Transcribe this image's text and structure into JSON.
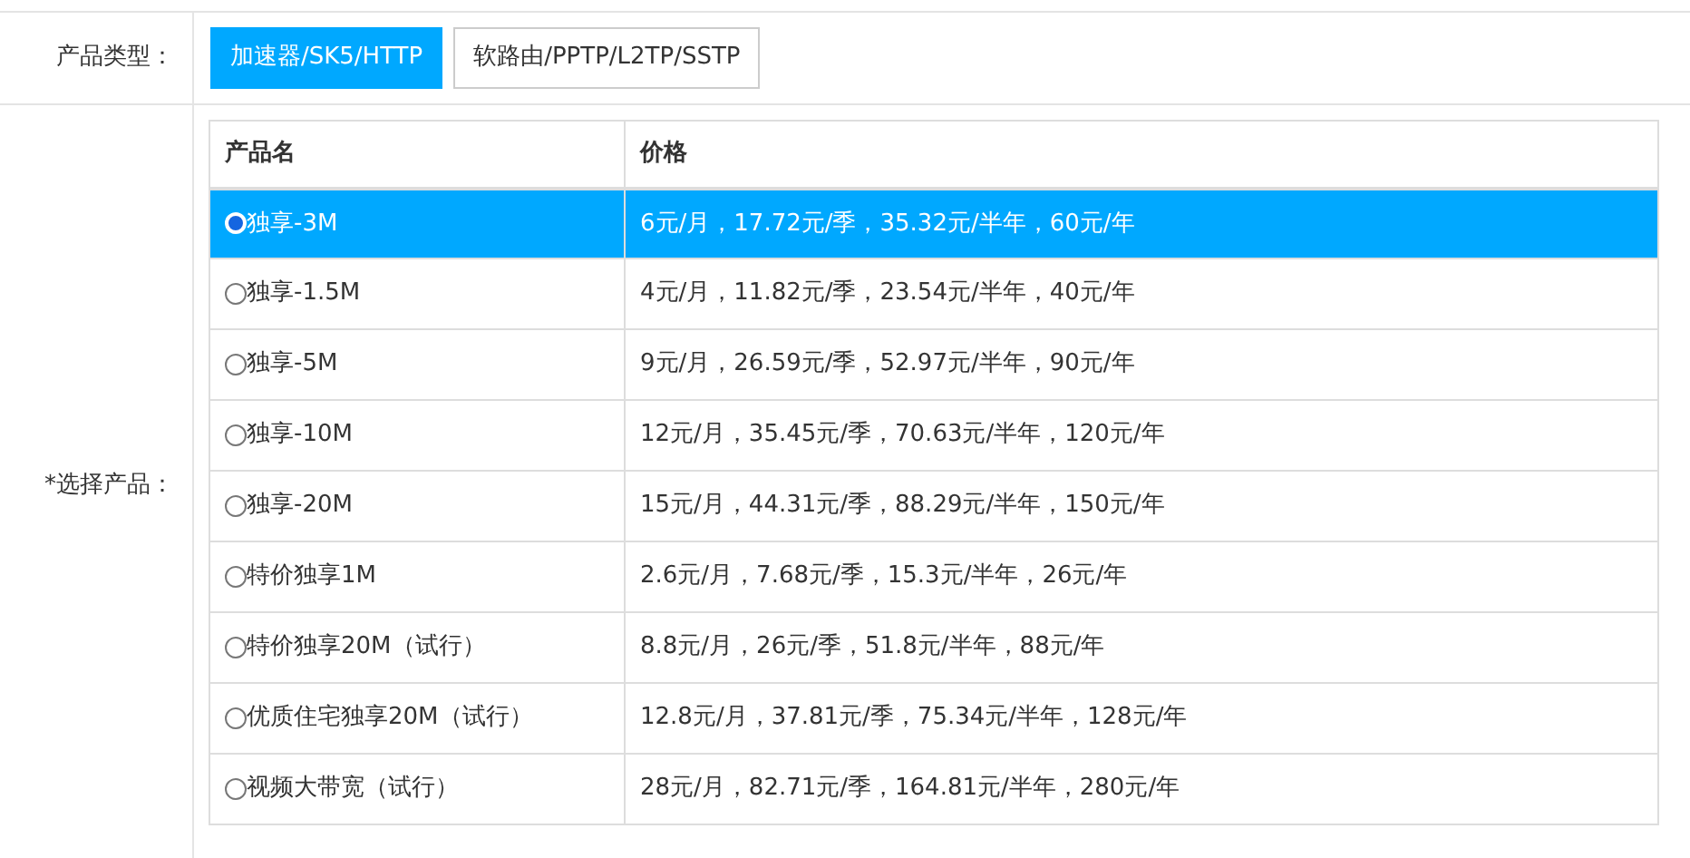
{
  "product_type": {
    "label": "产品类型：",
    "options": [
      {
        "label": "加速器/SK5/HTTP",
        "selected": true
      },
      {
        "label": "软路由/PPTP/L2TP/SSTP",
        "selected": false
      }
    ]
  },
  "product_select": {
    "label": "*选择产品：",
    "table": {
      "columns": [
        "产品名",
        "价格"
      ],
      "rows": [
        {
          "name": "独享-3M",
          "price": "6元/月，17.72元/季，35.32元/半年，60元/年",
          "selected": true
        },
        {
          "name": "独享-1.5M",
          "price": "4元/月，11.82元/季，23.54元/半年，40元/年",
          "selected": false
        },
        {
          "name": "独享-5M",
          "price": "9元/月，26.59元/季，52.97元/半年，90元/年",
          "selected": false
        },
        {
          "name": "独享-10M",
          "price": "12元/月，35.45元/季，70.63元/半年，120元/年",
          "selected": false
        },
        {
          "name": "独享-20M",
          "price": "15元/月，44.31元/季，88.29元/半年，150元/年",
          "selected": false
        },
        {
          "name": "特价独享1M",
          "price": "2.6元/月，7.68元/季，15.3元/半年，26元/年",
          "selected": false
        },
        {
          "name": "特价独享20M（试行）",
          "price": "8.8元/月，26元/季，51.8元/半年，88元/年",
          "selected": false
        },
        {
          "name": "优质住宅独享20M（试行）",
          "price": "12.8元/月，37.81元/季，75.34元/半年，128元/年",
          "selected": false
        },
        {
          "name": "视频大带宽（试行）",
          "price": "28元/月，82.71元/季，164.81元/半年，280元/年",
          "selected": false
        }
      ]
    }
  }
}
